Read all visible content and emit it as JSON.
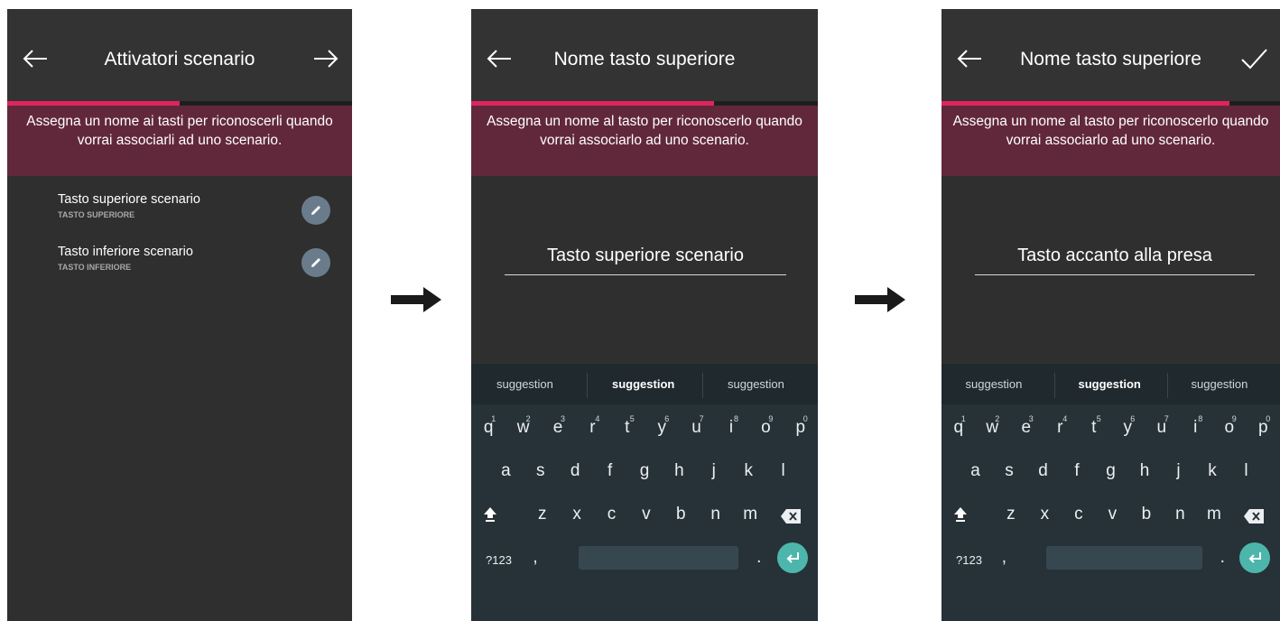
{
  "screen1": {
    "title": "Attivatori scenario",
    "back_icon": "arrow-left-icon",
    "next_icon": "arrow-right-icon",
    "progress": 0.5,
    "banner": "Assegna un nome ai tasti per riconoscerli quando vorrai associarli ad uno scenario.",
    "items": [
      {
        "label": "Tasto superiore scenario",
        "sublabel": "TASTO SUPERIORE"
      },
      {
        "label": "Tasto inferiore scenario",
        "sublabel": "TASTO INFERIORE"
      }
    ]
  },
  "screen2": {
    "title": "Nome tasto superiore",
    "back_icon": "arrow-left-icon",
    "progress": 0.7,
    "banner": "Assegna un nome al tasto per riconoscerlo quando vorrai associarlo ad uno scenario.",
    "input_value": "Tasto superiore scenario"
  },
  "screen3": {
    "title": "Nome tasto superiore",
    "back_icon": "arrow-left-icon",
    "confirm_icon": "checkmark-icon",
    "progress": 0.85,
    "banner": "Assegna un nome al tasto per riconoscerlo quando vorrai associarlo ad uno scenario.",
    "input_value": "Tasto accanto alla presa"
  },
  "flow_arrow_icon": "arrow-right-bold-icon",
  "keyboard": {
    "suggestions": [
      "suggestion",
      "suggestion",
      "suggestion"
    ],
    "row1": [
      "q",
      "w",
      "e",
      "r",
      "t",
      "y",
      "u",
      "i",
      "o",
      "p"
    ],
    "row1_numbers": [
      "1",
      "2",
      "3",
      "4",
      "5",
      "6",
      "7",
      "8",
      "9",
      "0"
    ],
    "row2": [
      "a",
      "s",
      "d",
      "f",
      "g",
      "h",
      "j",
      "k",
      "l"
    ],
    "row3": [
      "z",
      "x",
      "c",
      "v",
      "b",
      "n",
      "m"
    ],
    "symbols_key": "?123",
    "comma_key": ",",
    "period_key": ".",
    "shift_icon": "shift-icon",
    "backspace_icon": "backspace-icon",
    "enter_icon": "enter-icon"
  },
  "colors": {
    "accent": "#e0245e",
    "banner": "#61283b",
    "background": "#2f2f2f",
    "keyboard": "#263238",
    "enter": "#4db6ac"
  }
}
